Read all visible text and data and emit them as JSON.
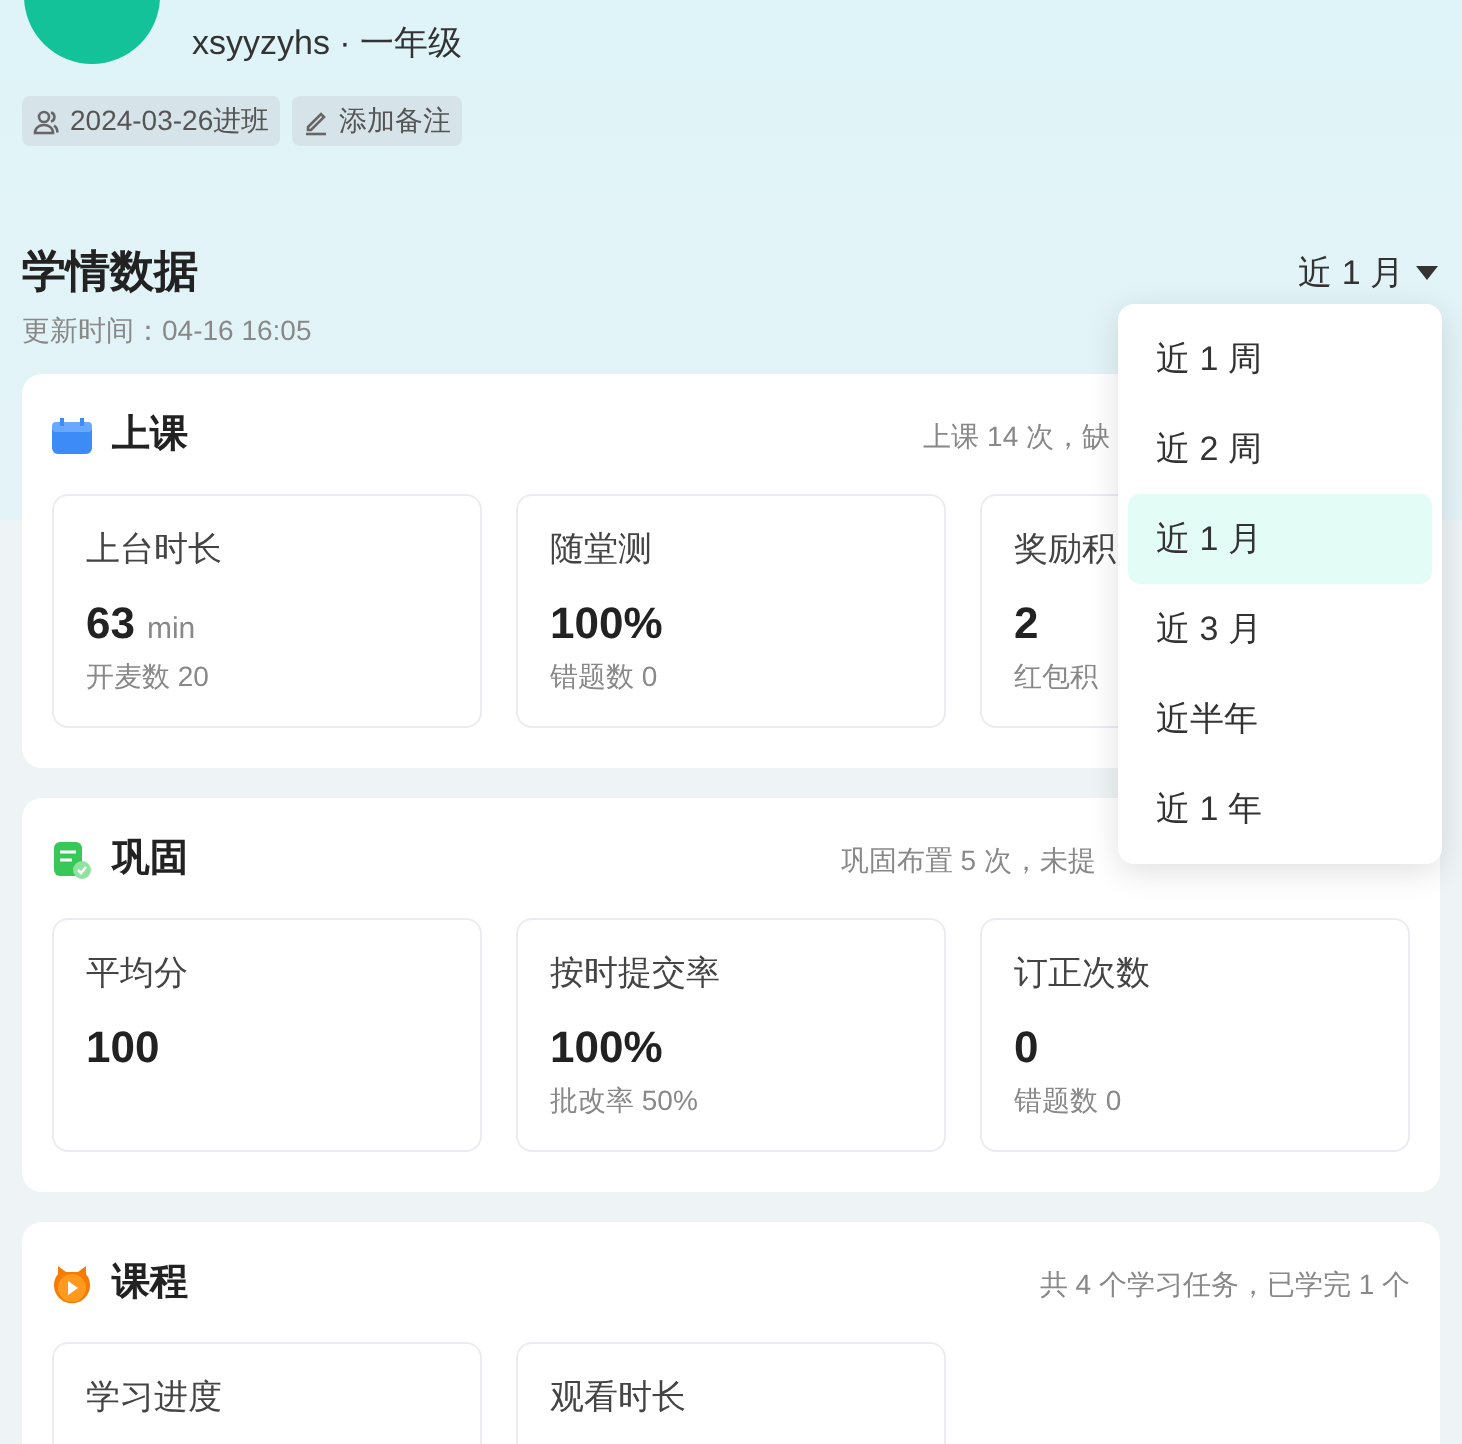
{
  "profile": {
    "subtitle": "xsyyzyhs · 一年级",
    "tags": [
      {
        "kind": "joined",
        "text": "2024-03-26进班"
      },
      {
        "kind": "note",
        "text": "添加备注"
      }
    ]
  },
  "header": {
    "title": "学情数据",
    "updated": "更新时间：04-16 16:05",
    "range": "近 1 月"
  },
  "range_menu": [
    {
      "label": "近 1 周",
      "selected": false
    },
    {
      "label": "近 2 周",
      "selected": false
    },
    {
      "label": "近 1 月",
      "selected": true
    },
    {
      "label": "近 3 月",
      "selected": false
    },
    {
      "label": "近半年",
      "selected": false
    },
    {
      "label": "近 1 年",
      "selected": false
    }
  ],
  "sections": [
    {
      "kind": "class",
      "title": "上课",
      "summary": "上课 14 次，缺",
      "stats": [
        {
          "label": "上台时长",
          "value": "63",
          "unit": "min",
          "sub": "开麦数 20"
        },
        {
          "label": "随堂测",
          "value": "100%",
          "sub": "错题数 0"
        },
        {
          "label": "奖励积",
          "value": "2",
          "sub": "红包积"
        }
      ]
    },
    {
      "kind": "practice",
      "title": "巩固",
      "summary": "巩固布置 5 次，未提",
      "stats": [
        {
          "label": "平均分",
          "value": "100"
        },
        {
          "label": "按时提交率",
          "value": "100%",
          "sub": "批改率 50%"
        },
        {
          "label": "订正次数",
          "value": "0",
          "sub": "错题数 0"
        }
      ]
    },
    {
      "kind": "course",
      "title": "课程",
      "summary": "共 4 个学习任务，已学完 1 个",
      "stats": [
        {
          "label": "学习进度"
        },
        {
          "label": "观看时长"
        }
      ]
    }
  ]
}
